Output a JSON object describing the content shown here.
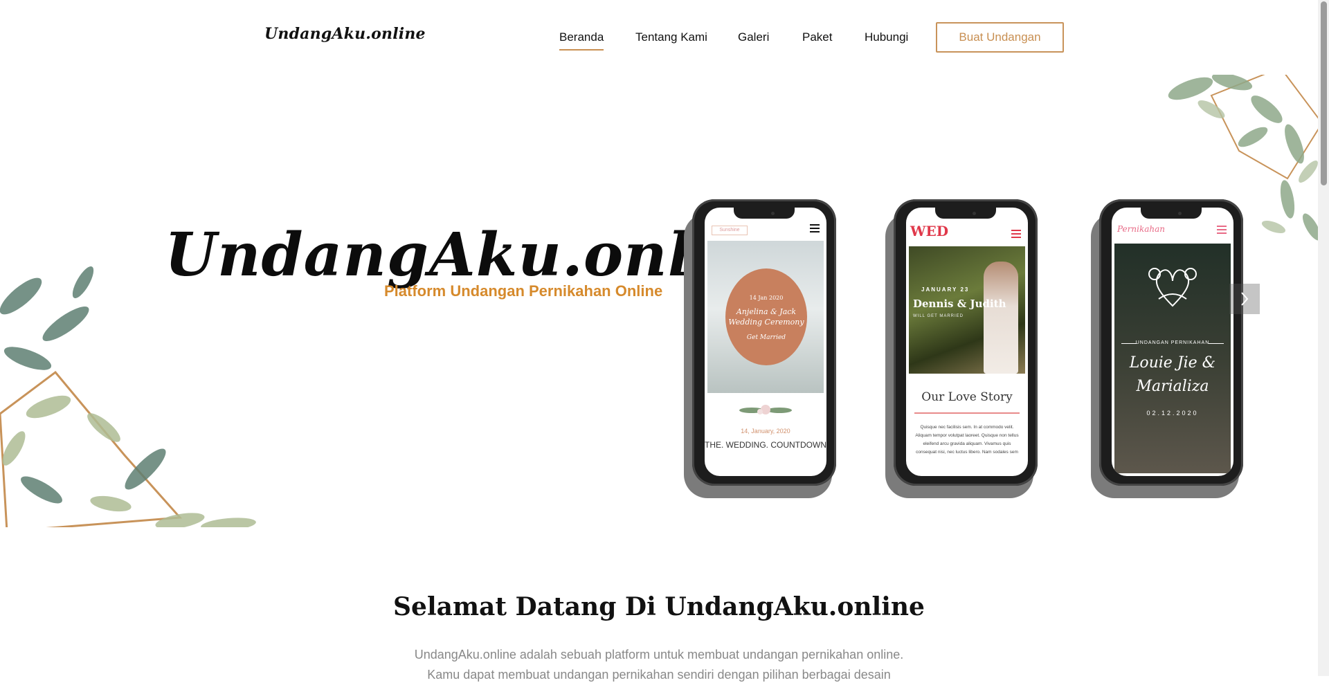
{
  "brand": "UndangAku.online",
  "nav": {
    "items": [
      {
        "label": "Beranda",
        "active": true
      },
      {
        "label": "Tentang Kami"
      },
      {
        "label": "Galeri"
      },
      {
        "label": "Paket"
      },
      {
        "label": "Hubungi"
      }
    ],
    "cta_label": "Buat Undangan"
  },
  "hero": {
    "logo": "UndangAku.online",
    "tagline": "Platform Undangan Pernikahan Online",
    "next_icon": "chevron-right-icon",
    "phones": [
      {
        "tag": "Sunshine",
        "date_badge": "14 Jan 2020",
        "names": "Anjelina & Jack",
        "ceremony": "Wedding Ceremony",
        "tagline": "Get Married",
        "date": "14, January, 2020",
        "countdown": "THE. WEDDING. COUNTDOWN"
      },
      {
        "logo": "WED",
        "date": "JANUARY 23",
        "names": "Dennis & Judith",
        "subtitle": "WILL GET MARRIED",
        "section": "Our Love Story",
        "lorem": "Quisque nec facilisis sem. In at commodo velit. Aliquam tempor volutpat laoreet. Quisque non tellus eleifend arcu gravida aliquam. Vivamus quis consequat nisi, nec luctus libero. Nam sodales sem"
      },
      {
        "logo": "Pernikahan",
        "subtitle": "UNDANGAN PERNIKAHAN",
        "names_line1": "Louie Jie &",
        "names_line2": "Marializa",
        "date": "02.12.2020"
      }
    ]
  },
  "welcome": {
    "title": "Selamat Datang Di UndangAku.online",
    "line1": "UndangAku.online adalah sebuah platform untuk membuat undangan pernikahan online.",
    "line2": "Kamu dapat membuat undangan pernikahan sendiri dengan pilihan berbagai desain"
  },
  "colors": {
    "accent": "#c88f52",
    "tagline": "#d68a2c",
    "text_muted": "#888888"
  }
}
